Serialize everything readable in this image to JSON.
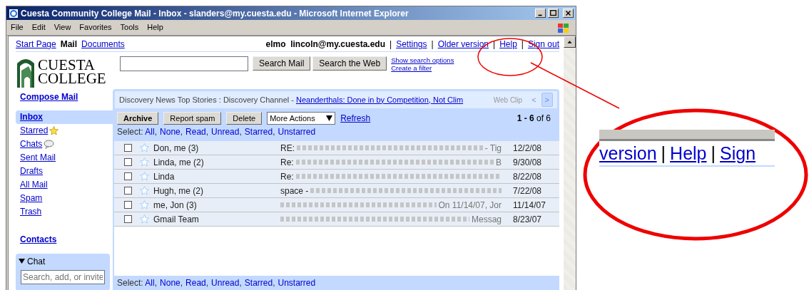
{
  "window": {
    "title": "Cuesta Community College Mail - Inbox - slanders@my.cuesta.edu - Microsoft Internet Explorer"
  },
  "menu": [
    "File",
    "Edit",
    "View",
    "Favorites",
    "Tools",
    "Help"
  ],
  "top_nav": {
    "apps": [
      {
        "label": "Start Page",
        "selected": false
      },
      {
        "label": "Mail",
        "selected": true
      },
      {
        "label": "Documents",
        "selected": false
      }
    ],
    "user": "elmo  lincoln@my.cuesta.edu",
    "separator": "|",
    "links": [
      "Settings",
      "Older version",
      "Help",
      "Sign out"
    ]
  },
  "logo": {
    "line_1": "CUESTA",
    "line_2": "COLLEGE"
  },
  "search": {
    "buttons": [
      "Search Mail",
      "Search the Web"
    ],
    "links": [
      "Show search options",
      "Create a filter"
    ]
  },
  "sidebar": {
    "compose": "Compose Mail",
    "folders": [
      {
        "label": "Inbox",
        "selected": true,
        "kind": "plain"
      },
      {
        "label": "Starred",
        "selected": false,
        "kind": "star"
      },
      {
        "label": "Chats",
        "selected": false,
        "kind": "chat"
      },
      {
        "label": "Sent Mail",
        "selected": false,
        "kind": "plain"
      },
      {
        "label": "Drafts",
        "selected": false,
        "kind": "plain"
      },
      {
        "label": "All Mail",
        "selected": false,
        "kind": "plain"
      },
      {
        "label": "Spam",
        "selected": false,
        "kind": "plain"
      },
      {
        "label": "Trash",
        "selected": false,
        "kind": "plain"
      }
    ],
    "contacts": "Contacts",
    "chat": {
      "title": "Chat",
      "expanded": true,
      "placeholder": "Search, add, or invite"
    }
  },
  "web_clip": {
    "source": "Discovery News Top Stories : Discovery Channel -",
    "headline": "Neanderthals: Done in by Competition, Not Clim",
    "label": "Web Clip",
    "prev": {
      "text": "<",
      "disabled": true
    },
    "next": {
      "text": ">",
      "disabled": false
    }
  },
  "toolbar": {
    "buttons": [
      {
        "label": "Archive",
        "bold": true
      },
      {
        "label": "Report spam",
        "bold": false
      },
      {
        "label": "Delete",
        "bold": false
      }
    ],
    "more_actions": "More Actions",
    "refresh": "Refresh",
    "count": "**1 - 6** of 6"
  },
  "select": {
    "label": "Select:",
    "separator": ",",
    "options": [
      "All",
      "None",
      "Read",
      "Unread",
      "Starred",
      "Unstarred"
    ]
  },
  "emails": [
    {
      "checked": false,
      "starred": false,
      "sender": "Don, me (3)",
      "subject_start": "RE:",
      "snippet_end": "- Tig",
      "date": "12/2/08"
    },
    {
      "checked": false,
      "starred": false,
      "sender": "Linda, me (2)",
      "subject_start": "Re:",
      "snippet_end": "B",
      "date": "9/30/08"
    },
    {
      "checked": false,
      "starred": false,
      "sender": "Linda",
      "subject_start": "Re:",
      "date": "8/22/08"
    },
    {
      "checked": false,
      "starred": false,
      "sender": "Hugh, me (2)",
      "subject_start": "space -",
      "date": "7/22/08"
    },
    {
      "checked": false,
      "starred": false,
      "sender": "me, Jon (3)",
      "snippet_end": "On 11/14/07, Jor",
      "date": "11/14/07"
    },
    {
      "checked": false,
      "starred": false,
      "sender": "Gmail Team",
      "snippet_end": "Messag",
      "date": "8/23/07"
    }
  ],
  "bottom_select": {
    "label": "Select:",
    "separator": ",",
    "options": [
      "All",
      "None",
      "Read",
      "Unread",
      "Starred",
      "Unstarred"
    ]
  },
  "callout": {
    "separator": "|",
    "links": [
      "version",
      "Help",
      "Sign"
    ]
  }
}
